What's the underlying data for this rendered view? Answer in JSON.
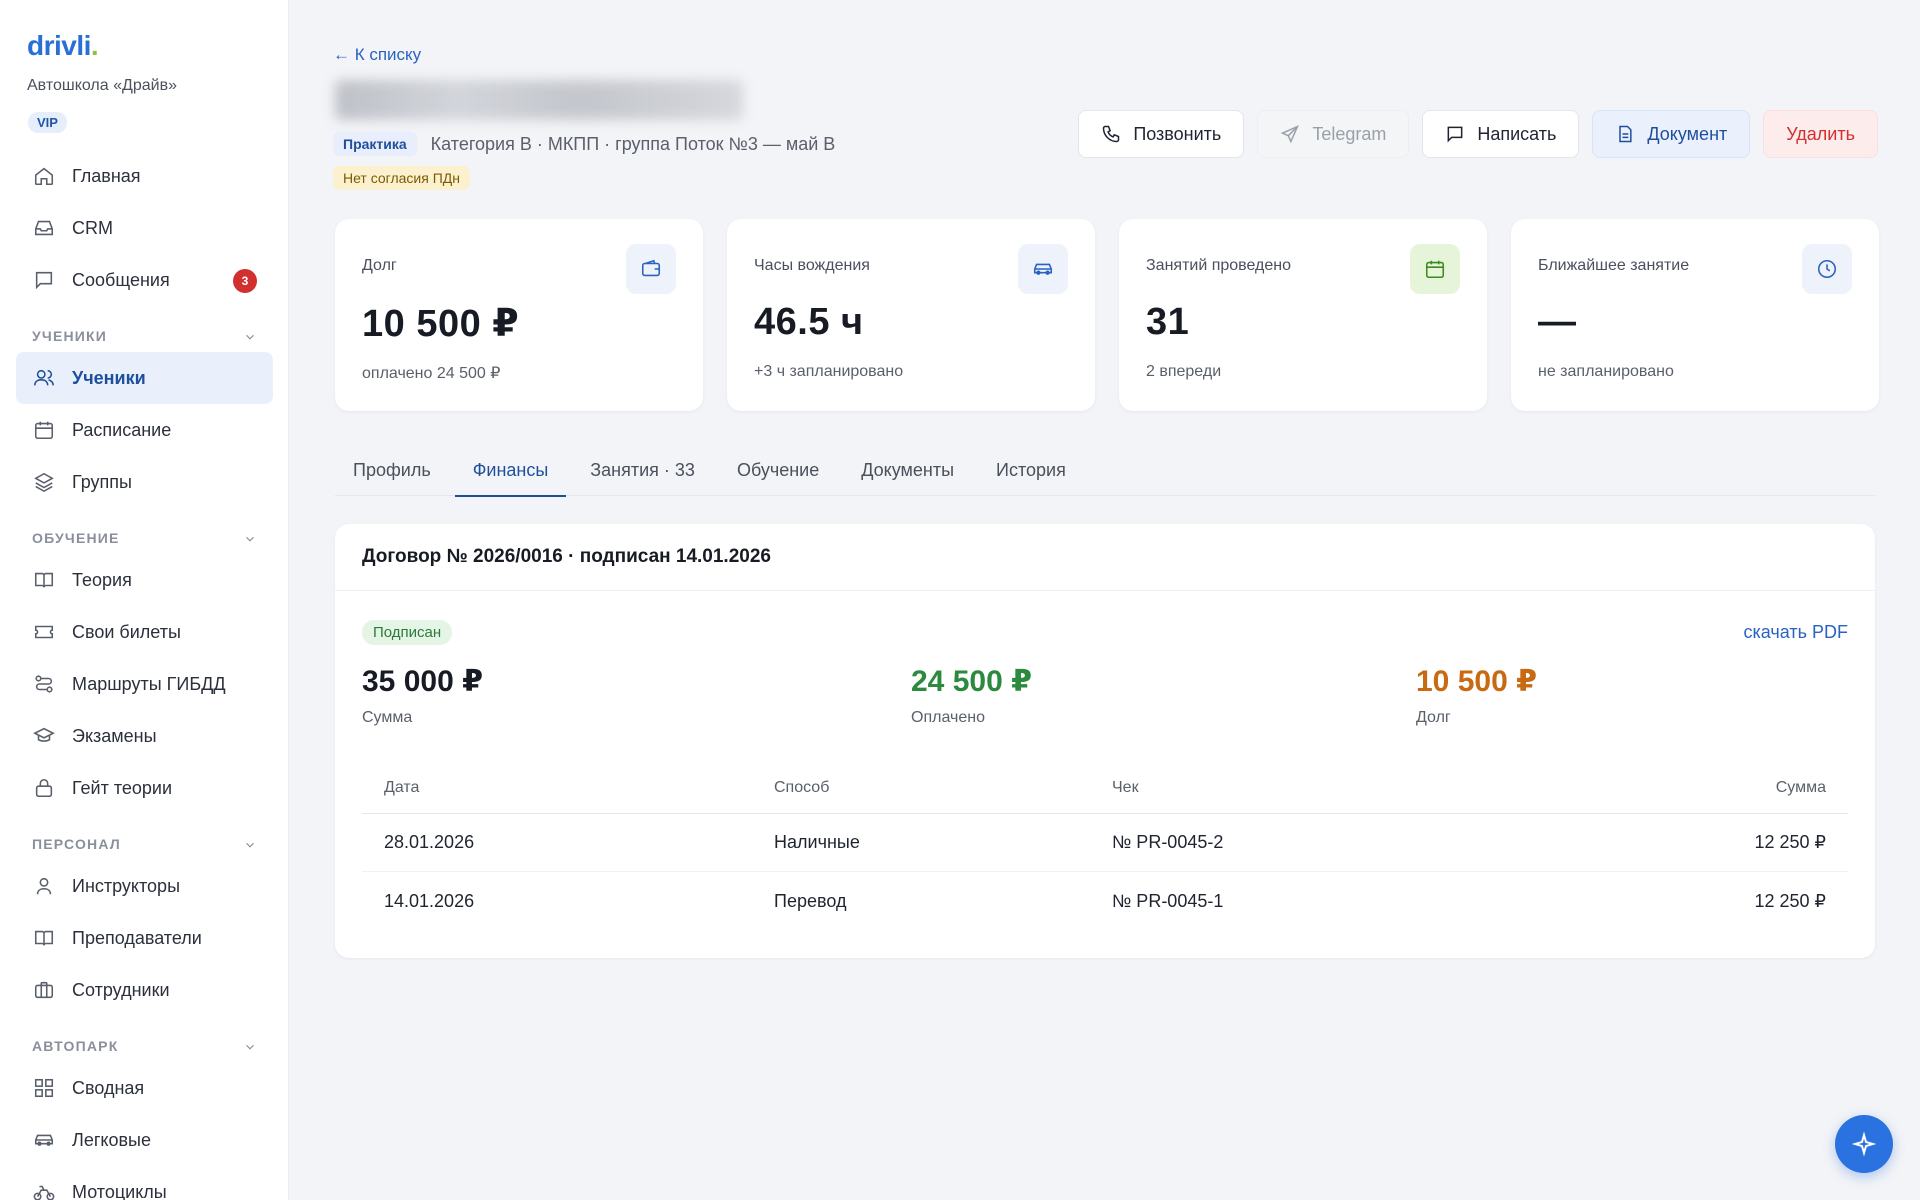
{
  "sidebar": {
    "brand": "drivli",
    "school": "Автошкола «Драйв»",
    "vip": "VIP",
    "top_items": [
      {
        "label": "Главная",
        "icon": "home-icon"
      },
      {
        "label": "CRM",
        "icon": "inbox-icon"
      },
      {
        "label": "Сообщения",
        "icon": "chat-icon",
        "badge": "3"
      }
    ],
    "sections": [
      {
        "title": "УЧЕНИКИ",
        "items": [
          {
            "label": "Ученики",
            "icon": "users-icon",
            "active": true
          },
          {
            "label": "Расписание",
            "icon": "calendar-icon"
          },
          {
            "label": "Группы",
            "icon": "layers-icon"
          }
        ]
      },
      {
        "title": "ОБУЧЕНИЕ",
        "items": [
          {
            "label": "Теория",
            "icon": "book-icon"
          },
          {
            "label": "Свои билеты",
            "icon": "ticket-icon"
          },
          {
            "label": "Маршруты ГИБДД",
            "icon": "route-icon"
          },
          {
            "label": "Экзамены",
            "icon": "graduation-icon"
          },
          {
            "label": "Гейт теории",
            "icon": "lock-icon"
          }
        ]
      },
      {
        "title": "ПЕРСОНАЛ",
        "items": [
          {
            "label": "Инструкторы",
            "icon": "user-icon"
          },
          {
            "label": "Преподаватели",
            "icon": "book-open-icon"
          },
          {
            "label": "Сотрудники",
            "icon": "briefcase-icon"
          }
        ]
      },
      {
        "title": "АВТОПАРК",
        "items": [
          {
            "label": "Сводная",
            "icon": "grid-icon"
          },
          {
            "label": "Легковые",
            "icon": "car-icon"
          },
          {
            "label": "Мотоциклы",
            "icon": "bike-icon"
          }
        ]
      }
    ]
  },
  "header": {
    "back_label": "← К списку",
    "chip_practice": "Практика",
    "subtitle": "Категория B · МКПП · группа Поток №3 — май B",
    "chip_consent": "Нет согласия ПДн"
  },
  "actions": {
    "call": "Позвонить",
    "telegram": "Telegram",
    "write": "Написать",
    "document": "Документ",
    "delete": "Удалить"
  },
  "stats": [
    {
      "label": "Долг",
      "value": "10 500 ₽",
      "sub": "оплачено 24 500 ₽",
      "icon": "wallet-icon"
    },
    {
      "label": "Часы вождения",
      "value": "46.5 ч",
      "sub": "+3 ч запланировано",
      "icon": "car-icon"
    },
    {
      "label": "Занятий проведено",
      "value": "31",
      "sub": "2 впереди",
      "icon": "calendar-icon"
    },
    {
      "label": "Ближайшее занятие",
      "value": "—",
      "sub": "не запланировано",
      "icon": "clock-icon"
    }
  ],
  "tabs": [
    "Профиль",
    "Финансы",
    "Занятия · 33",
    "Обучение",
    "Документы",
    "История"
  ],
  "contract": {
    "title": "Договор № 2026/0016 · подписан 14.01.2026",
    "status": "Подписан",
    "pdf_link": "скачать PDF",
    "total": {
      "amount": "35 000 ₽",
      "caption": "Сумма"
    },
    "paid": {
      "amount": "24 500 ₽",
      "caption": "Оплачено"
    },
    "debt": {
      "amount": "10 500 ₽",
      "caption": "Долг"
    },
    "columns": [
      "Дата",
      "Способ",
      "Чек",
      "Сумма"
    ],
    "rows": [
      [
        "28.01.2026",
        "Наличные",
        "№ PR-0045-2",
        "12 250 ₽"
      ],
      [
        "14.01.2026",
        "Перевод",
        "№ PR-0045-1",
        "12 250 ₽"
      ]
    ]
  },
  "colors": {
    "accent": "#1f4f9c",
    "paid": "#2c8a3f",
    "debt": "#c76a12",
    "danger": "#d32f2f"
  }
}
